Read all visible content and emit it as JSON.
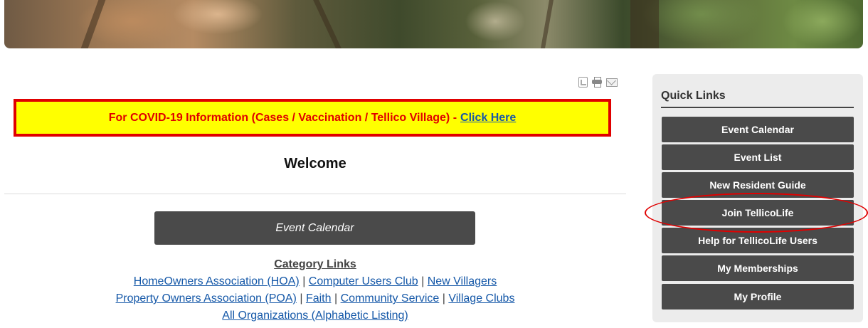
{
  "print_tools": [
    "pdf-icon",
    "printer-icon",
    "email-icon"
  ],
  "covid": {
    "text": "For COVID-19 Information (Cases / Vaccination / Tellico Village) -",
    "link": "Click Here"
  },
  "welcome": "Welcome",
  "main": {
    "event_button": "Event Calendar"
  },
  "category": {
    "title": "Category Links",
    "sep": "|",
    "row1": [
      "HomeOwners Association (HOA)",
      "Computer Users Club",
      "New Villagers"
    ],
    "row2": [
      "Property Owners Association (POA)",
      "Faith",
      "Community Service",
      "Village Clubs"
    ],
    "row3": [
      "All Organizations (Alphabetic Listing)"
    ]
  },
  "quick_links": {
    "title": "Quick Links",
    "items": [
      "Event Calendar",
      "Event List",
      "New Resident Guide",
      "Join TellicoLife",
      "Help for TellicoLife Users",
      "My Memberships",
      "My Profile"
    ]
  },
  "colors": {
    "alert_red": "#e00000",
    "alert_yellow": "#ffff00",
    "link_blue": "#1558a8",
    "button_dark": "#4a4a4a"
  }
}
